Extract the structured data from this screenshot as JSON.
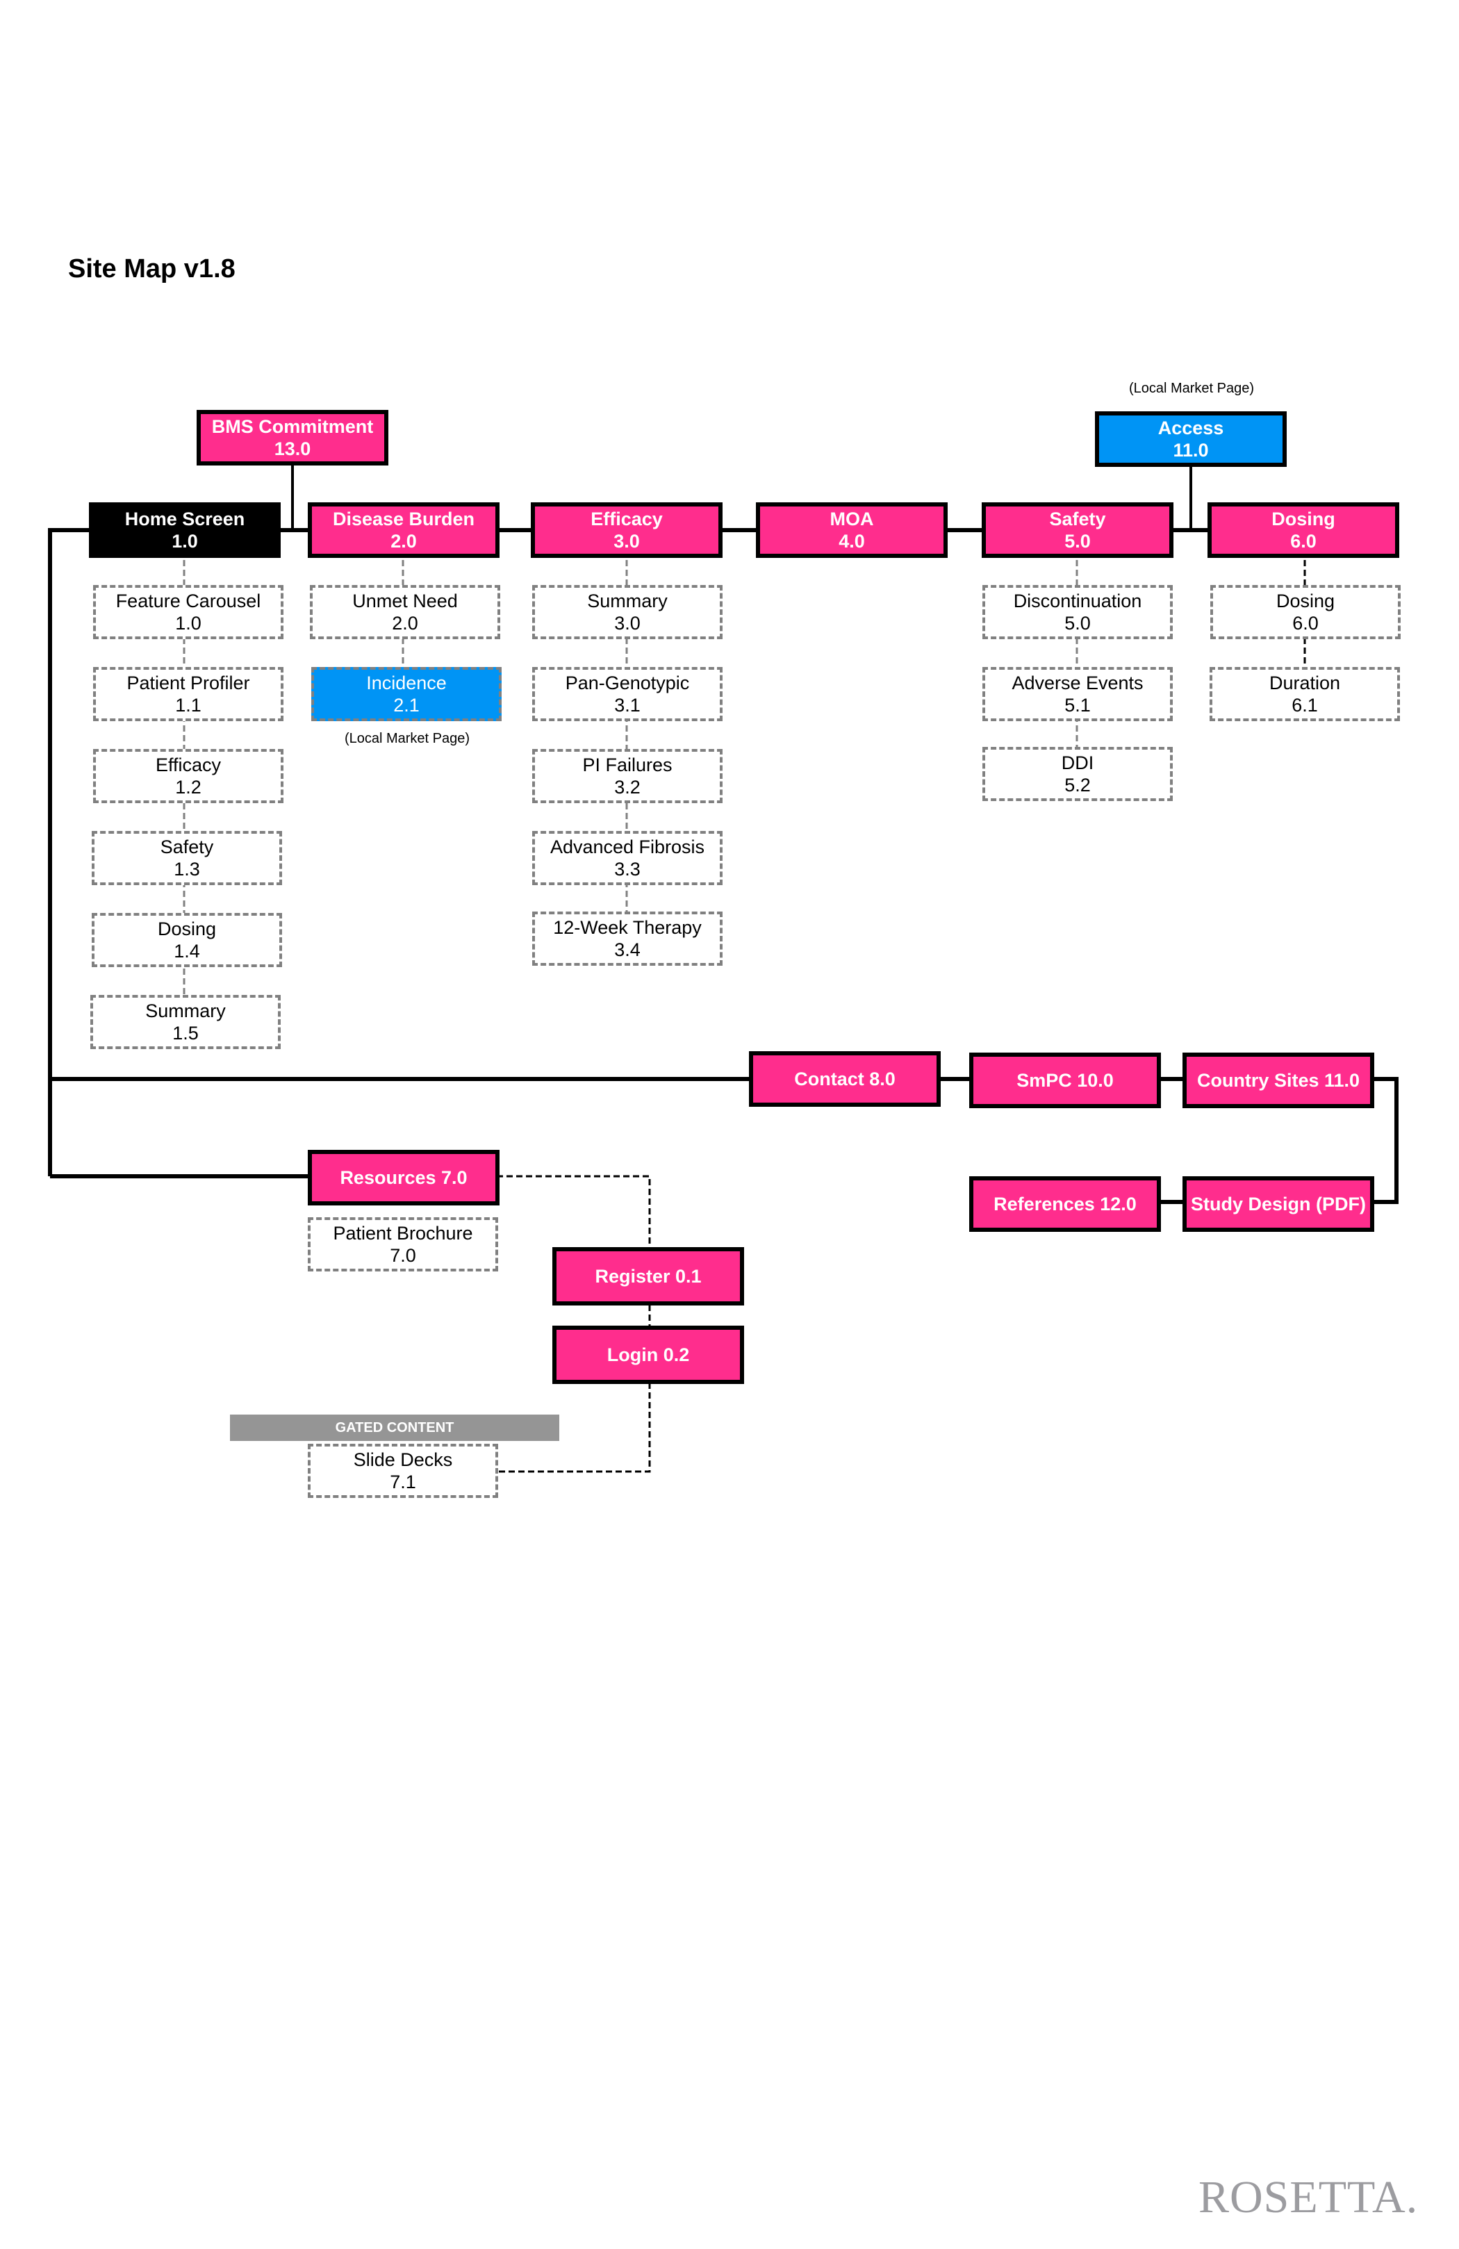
{
  "title": "Site Map v1.8",
  "local_market_note": "(Local Market Page)",
  "gated_label": "GATED CONTENT",
  "logo": "ROSETTA.",
  "colors": {
    "primary": "#ff2d8d",
    "home": "#000000",
    "local": "#0094f5",
    "gated": "#959595",
    "logo": "#9c9ca0"
  },
  "top_nodes": {
    "bms": {
      "label": "BMS Commitment",
      "num": "13.0"
    },
    "access": {
      "label": "Access",
      "num": "11.0"
    },
    "home": {
      "label": "Home Screen",
      "num": "1.0"
    },
    "disease": {
      "label": "Disease Burden",
      "num": "2.0"
    },
    "efficacy": {
      "label": "Efficacy",
      "num": "3.0"
    },
    "moa": {
      "label": "MOA",
      "num": "4.0"
    },
    "safety": {
      "label": "Safety",
      "num": "5.0"
    },
    "dosing": {
      "label": "Dosing",
      "num": "6.0"
    }
  },
  "home_children": [
    {
      "label": "Feature Carousel",
      "num": "1.0"
    },
    {
      "label": "Patient Profiler",
      "num": "1.1"
    },
    {
      "label": "Efficacy",
      "num": "1.2"
    },
    {
      "label": "Safety",
      "num": "1.3"
    },
    {
      "label": "Dosing",
      "num": "1.4"
    },
    {
      "label": "Summary",
      "num": "1.5"
    }
  ],
  "disease_children": [
    {
      "label": "Unmet Need",
      "num": "2.0"
    },
    {
      "label": "Incidence",
      "num": "2.1"
    }
  ],
  "efficacy_children": [
    {
      "label": "Summary",
      "num": "3.0"
    },
    {
      "label": "Pan-Genotypic",
      "num": "3.1"
    },
    {
      "label": "PI Failures",
      "num": "3.2"
    },
    {
      "label": "Advanced Fibrosis",
      "num": "3.3"
    },
    {
      "label": "12-Week Therapy",
      "num": "3.4"
    }
  ],
  "safety_children": [
    {
      "label": "Discontinuation",
      "num": "5.0"
    },
    {
      "label": "Adverse Events",
      "num": "5.1"
    },
    {
      "label": "DDI",
      "num": "5.2"
    }
  ],
  "dosing_children": [
    {
      "label": "Dosing",
      "num": "6.0"
    },
    {
      "label": "Duration",
      "num": "6.1"
    }
  ],
  "secondary_nodes": {
    "contact": "Contact 8.0",
    "smpc": "SmPC  10.0",
    "country": "Country Sites  11.0",
    "references": "References  12.0",
    "study": "Study Design (PDF)",
    "resources": "Resources 7.0",
    "register": "Register 0.1",
    "login": "Login 0.2"
  },
  "resources_children": [
    {
      "label": "Patient Brochure",
      "num": "7.0"
    },
    {
      "label": "Slide Decks",
      "num": "7.1"
    }
  ]
}
